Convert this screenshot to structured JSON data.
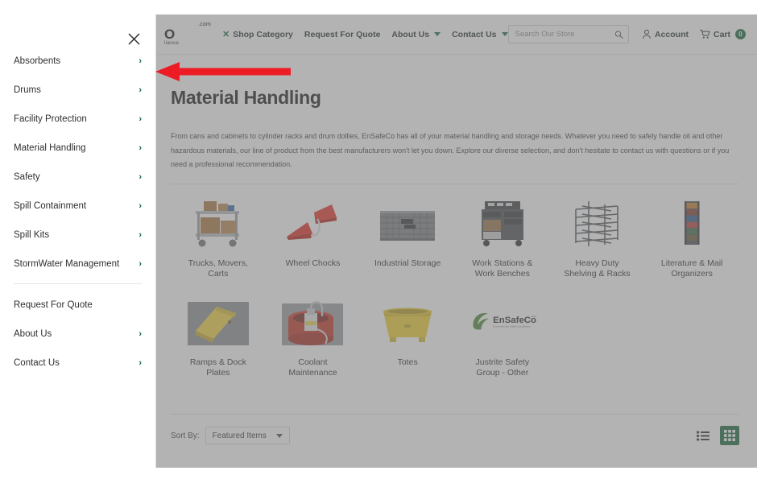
{
  "header": {
    "logo": {
      "top": ".com",
      "mid": "O",
      "bottom": "liance"
    },
    "nav": [
      {
        "label": "Shop Category",
        "icon": "close-x-icon",
        "has_caret": false
      },
      {
        "label": "Request For Quote",
        "has_caret": false
      },
      {
        "label": "About Us",
        "has_caret": true
      },
      {
        "label": "Contact Us",
        "has_caret": true
      }
    ],
    "search": {
      "placeholder": "Search Our Store",
      "value": "",
      "icon": "search-icon"
    },
    "account": {
      "label": "Account",
      "icon": "user-icon"
    },
    "cart": {
      "label": "Cart",
      "icon": "cart-icon",
      "count": "0"
    }
  },
  "page": {
    "title": "Material Handling",
    "description": "From cans and cabinets to cylinder racks and drum dollies, EnSafeCo has all of your material handling and storage needs. Whatever you need to safely handle oil and other hazardous materials, our line of product from the best manufacturers won't let you down. Explore our diverse selection, and don't hesitate to contact us with questions or if you need a professional recommendation."
  },
  "categories": [
    {
      "name": "Trucks, Movers, Carts",
      "icon": "utility-cart-icon"
    },
    {
      "name": "Wheel Chocks",
      "icon": "wheel-chock-icon"
    },
    {
      "name": "Industrial Storage",
      "icon": "industrial-cabinet-icon"
    },
    {
      "name": "Work Stations & Work Benches",
      "icon": "workbench-icon"
    },
    {
      "name": "Heavy Duty Shelving & Racks",
      "icon": "shelving-rack-icon"
    },
    {
      "name": "Literature & Mail Organizers",
      "icon": "literature-rack-icon"
    },
    {
      "name": "Ramps & Dock Plates",
      "icon": "dock-plate-icon"
    },
    {
      "name": "Coolant Maintenance",
      "icon": "coolant-drum-icon"
    },
    {
      "name": "Totes",
      "icon": "tote-icon"
    },
    {
      "name": "Justrite Safety Group - Other",
      "icon": "ensafeco-logo-icon",
      "logo_text": "EnSafeCo"
    }
  ],
  "sortbar": {
    "sort_label": "Sort By:",
    "sort_value": "Featured Items",
    "view_list_icon": "list-view-icon",
    "view_grid_icon": "grid-view-icon",
    "active_view": "grid"
  },
  "drawer": {
    "close_icon": "close-icon",
    "chevron": "›",
    "items": [
      {
        "label": "Absorbents",
        "chevron": true
      },
      {
        "label": "Drums",
        "chevron": true
      },
      {
        "label": "Facility Protection",
        "chevron": true
      },
      {
        "label": "Material Handling",
        "chevron": true
      },
      {
        "label": "Safety",
        "chevron": true
      },
      {
        "label": "Spill Containment",
        "chevron": true
      },
      {
        "label": "Spill Kits",
        "chevron": true
      },
      {
        "label": "StormWater Management",
        "chevron": true
      }
    ],
    "secondary_items": [
      {
        "label": "Request For Quote",
        "chevron": false
      },
      {
        "label": "About Us",
        "chevron": true
      },
      {
        "label": "Contact Us",
        "chevron": true
      }
    ]
  },
  "annotation": {
    "type": "arrow-left",
    "color": "#ED1C24"
  },
  "colors": {
    "brand_green": "#17683c",
    "accent_red": "#ED1C24",
    "text": "#2f2f2f"
  }
}
